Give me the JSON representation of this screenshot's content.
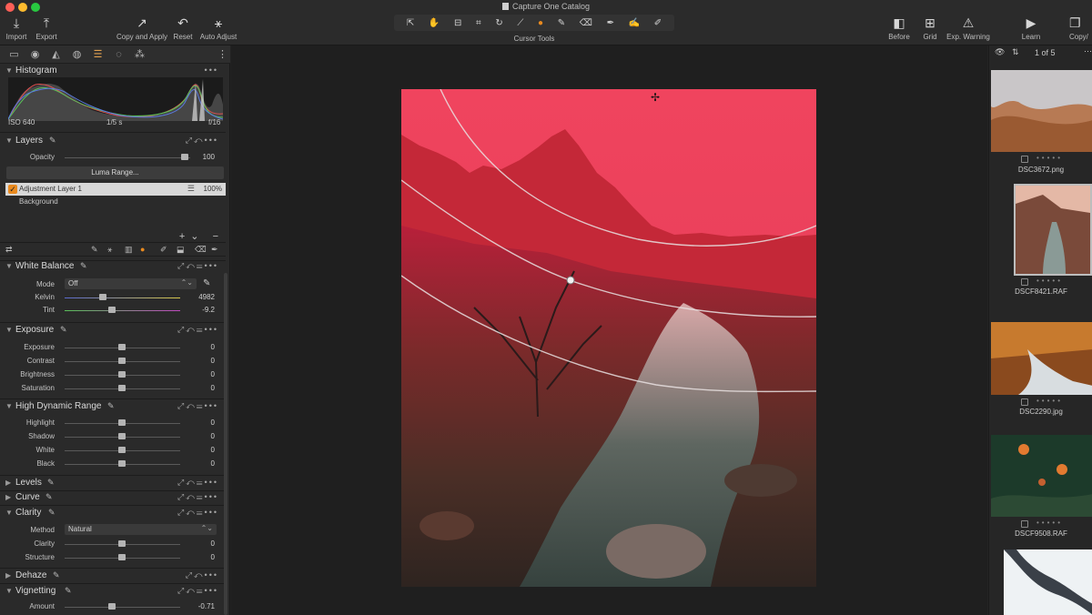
{
  "window": {
    "title": "Capture One Catalog"
  },
  "toolbar": {
    "import": "Import",
    "export": "Export",
    "copy_apply": "Copy and Apply",
    "reset": "Reset",
    "auto_adjust": "Auto Adjust",
    "cursor_tools": "Cursor Tools",
    "before": "Before",
    "grid": "Grid",
    "exp_warning": "Exp. Warning",
    "learn": "Learn",
    "copy_truncated": "Copy/"
  },
  "histogram": {
    "title": "Histogram",
    "iso": "ISO 640",
    "shutter": "1/5 s",
    "aperture": "f/16"
  },
  "layers": {
    "title": "Layers",
    "opacity_label": "Opacity",
    "opacity_value": "100",
    "opacity_level": 0.96,
    "luma_range": "Luma Range...",
    "active_layer": "Adjustment Layer 1",
    "active_layer_opacity": "100%",
    "background": "Background"
  },
  "white_balance": {
    "title": "White Balance",
    "mode_label": "Mode",
    "mode_value": "Off",
    "kelvin_label": "Kelvin",
    "kelvin_value": "4982",
    "tint_label": "Tint",
    "tint_value": "-9.2"
  },
  "exposure": {
    "title": "Exposure",
    "rows": [
      {
        "label": "Exposure",
        "value": "0"
      },
      {
        "label": "Contrast",
        "value": "0"
      },
      {
        "label": "Brightness",
        "value": "0"
      },
      {
        "label": "Saturation",
        "value": "0"
      }
    ]
  },
  "hdr": {
    "title": "High Dynamic Range",
    "rows": [
      {
        "label": "Highlight",
        "value": "0"
      },
      {
        "label": "Shadow",
        "value": "0"
      },
      {
        "label": "White",
        "value": "0"
      },
      {
        "label": "Black",
        "value": "0"
      }
    ]
  },
  "levels": {
    "title": "Levels"
  },
  "curve": {
    "title": "Curve"
  },
  "clarity": {
    "title": "Clarity",
    "method_label": "Method",
    "method_value": "Natural",
    "rows": [
      {
        "label": "Clarity",
        "value": "0"
      },
      {
        "label": "Structure",
        "value": "0"
      }
    ]
  },
  "dehaze": {
    "title": "Dehaze"
  },
  "vignetting": {
    "title": "Vignetting",
    "amount_label": "Amount",
    "amount_value": "-0.71"
  },
  "browser": {
    "count": "1 of 5",
    "files": [
      "DSC3672.png",
      "DSCF8421.RAF",
      "DSC2290.jpg",
      "DSCF9508.RAF"
    ]
  }
}
